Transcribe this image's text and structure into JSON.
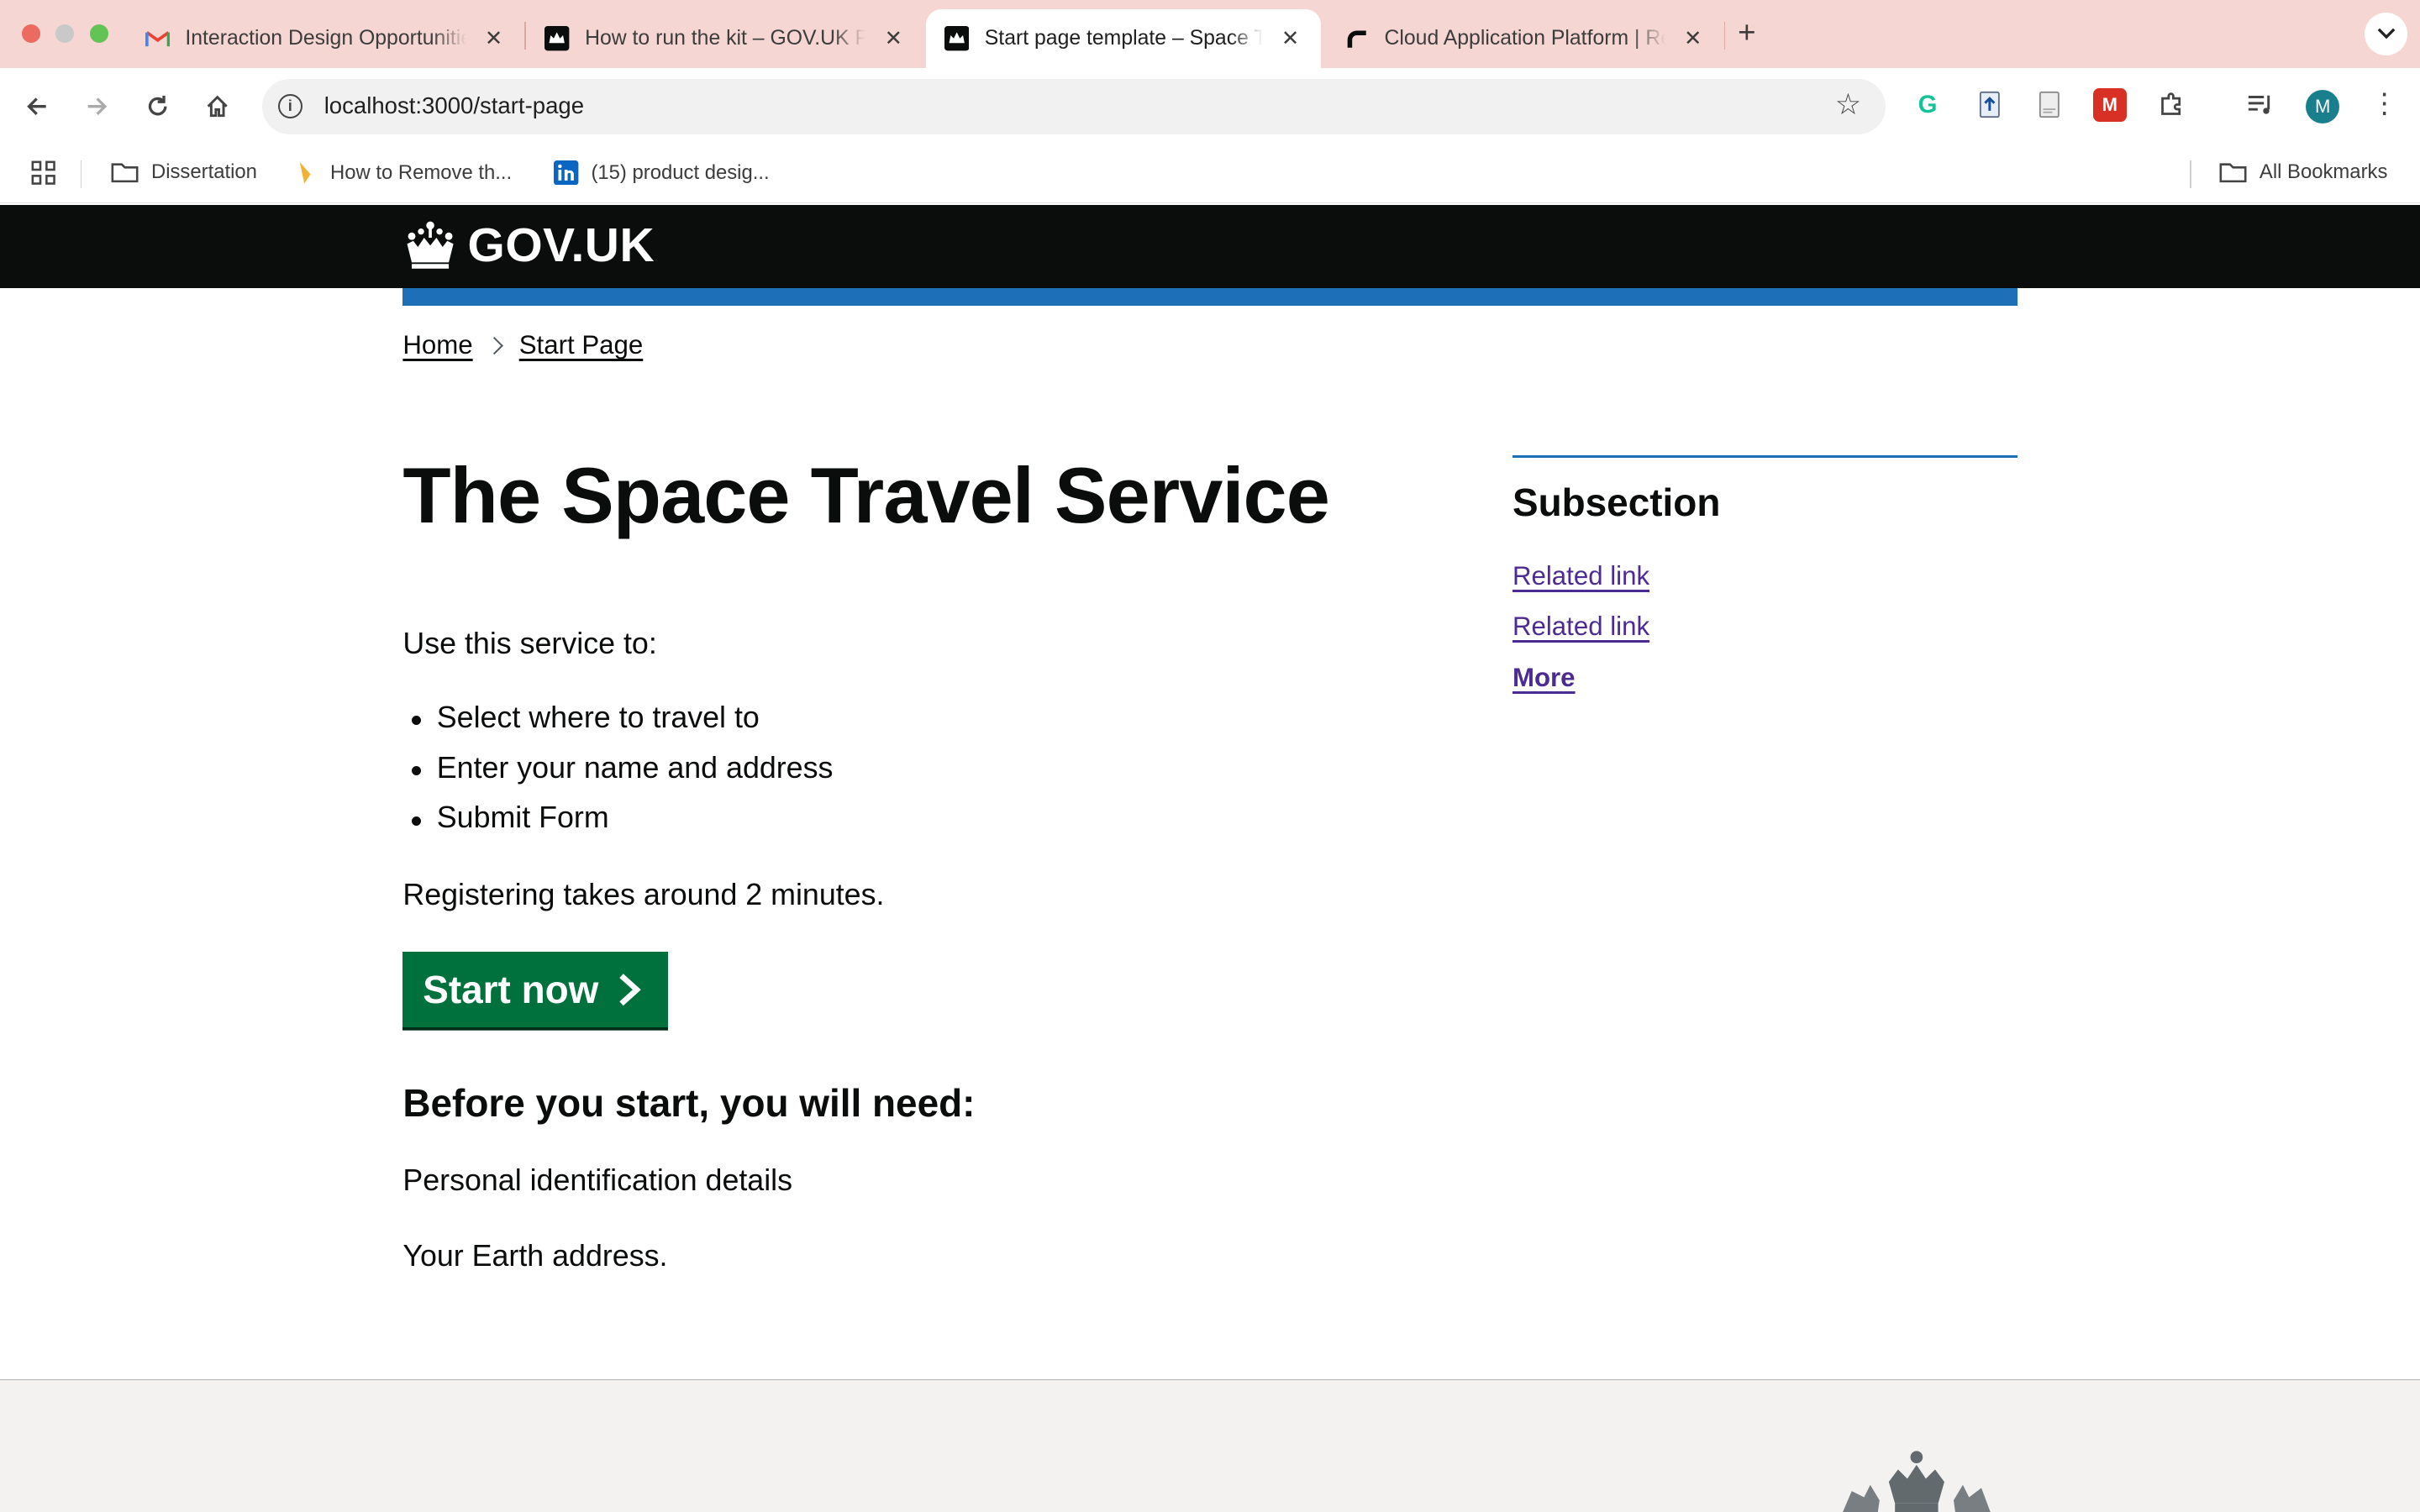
{
  "browser": {
    "tabs": [
      {
        "label": "Interaction Design Opportunities",
        "icon": "gmail-icon",
        "active": false
      },
      {
        "label": "How to run the kit – GOV.UK Prototype Kit",
        "icon": "govuk-crown-icon",
        "active": false
      },
      {
        "label": "Start page template – Space Travel",
        "icon": "govuk-crown-icon",
        "active": true
      },
      {
        "label": "Cloud Application Platform | Render",
        "icon": "render-icon",
        "active": false
      }
    ],
    "url": "localhost:3000/start-page",
    "bookmarks": [
      {
        "label": "Dissertation",
        "icon": "folder-icon"
      },
      {
        "label": "How to Remove th...",
        "icon": "bookmark-icon"
      },
      {
        "label": "(15) product desig...",
        "icon": "linkedin-icon"
      }
    ],
    "all_bookmarks_label": "All Bookmarks",
    "profile_initial": "M"
  },
  "header": {
    "logo_text": "GOV.UK"
  },
  "breadcrumbs": [
    {
      "label": "Home"
    },
    {
      "label": "Start Page"
    }
  ],
  "main": {
    "title": "The Space Travel Service",
    "intro": "Use this service to:",
    "bullets": [
      "Select where to travel to",
      "Enter your name and address",
      "Submit Form"
    ],
    "duration": "Registering takes around 2 minutes.",
    "start_button": "Start now",
    "before_heading": "Before you start, you will need:",
    "needs": [
      "Personal identification details",
      "Your Earth address."
    ]
  },
  "aside": {
    "title": "Subsection",
    "links": [
      "Related link",
      "Related link"
    ],
    "more": "More"
  },
  "colors": {
    "header_bg": "#0b0c0c",
    "blue_bar": "#1d70b8",
    "start_button": "#00703c",
    "link": "#4c2c92",
    "footer_bg": "#f3f2f1",
    "tabstrip_bg": "#f6d6d2"
  }
}
